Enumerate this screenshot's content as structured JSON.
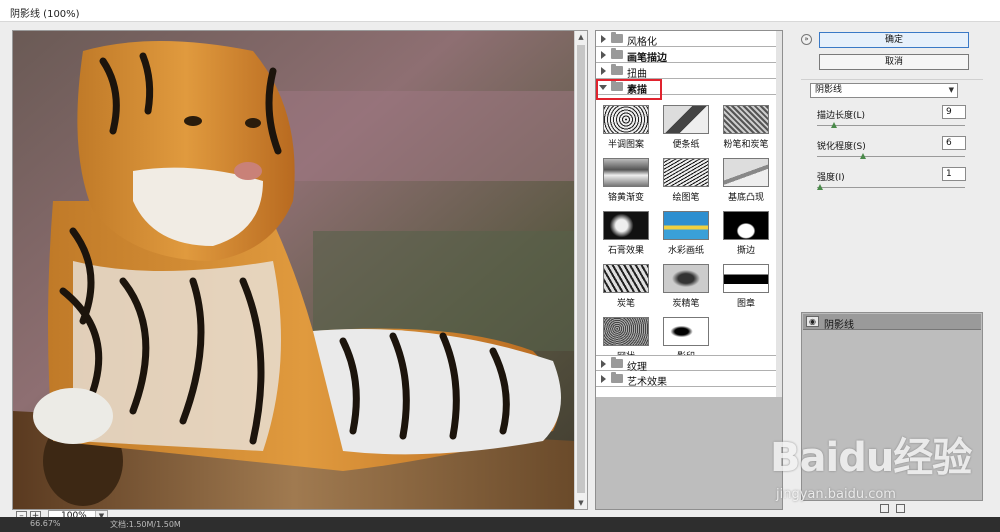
{
  "window": {
    "title": "阴影线 (100%)"
  },
  "preview": {
    "zoom": "100%",
    "zoom_minus": "–",
    "zoom_plus": "+"
  },
  "gallery": {
    "folders_top": [
      {
        "label": "风格化",
        "bold": false,
        "open": false
      },
      {
        "label": "画笔描边",
        "bold": true,
        "open": false
      },
      {
        "label": "扭曲",
        "bold": false,
        "open": false
      },
      {
        "label": "素描",
        "bold": true,
        "open": true
      }
    ],
    "sketch_filters": [
      "半调图案",
      "便条纸",
      "粉笔和炭笔",
      "铬黄渐变",
      "绘图笔",
      "基底凸现",
      "石膏效果",
      "水彩画纸",
      "撕边",
      "炭笔",
      "炭精笔",
      "图章",
      "网状",
      "影印"
    ],
    "folders_bottom": [
      {
        "label": "纹理"
      },
      {
        "label": "艺术效果"
      }
    ]
  },
  "buttons": {
    "ok": "确定",
    "cancel": "取消",
    "collapse": "»"
  },
  "settings": {
    "filter_select": "阴影线",
    "params": [
      {
        "label": "描边长度(L)",
        "value": "9",
        "fraction": 0.1
      },
      {
        "label": "锐化程度(S)",
        "value": "6",
        "fraction": 0.3
      },
      {
        "label": "强度(I)",
        "value": "1",
        "fraction": 0.0
      }
    ]
  },
  "layers": {
    "items": [
      {
        "name": "阴影线"
      }
    ]
  },
  "status": {
    "zoom": "66.67%",
    "doc": "文档:1.50M/1.50M"
  },
  "watermark": {
    "brand": "Baidu经验",
    "url": "jingyan.baidu.com"
  },
  "colors": {
    "accent": "#3a79c6",
    "highlight": "#e0232e"
  }
}
